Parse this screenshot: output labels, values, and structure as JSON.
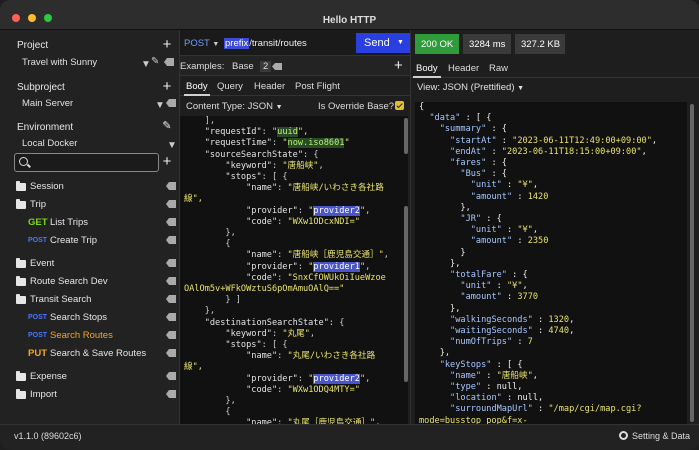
{
  "window": {
    "title": "Hello HTTP"
  },
  "colors": {
    "get": "#7ed321",
    "post": "#4a76ff",
    "put": "#f5a623",
    "ok": "#2e9c3a",
    "send": "#2a3fe0"
  },
  "sidebar": {
    "project_label": "Project",
    "project_value": "Travel with Sunny",
    "subproject_label": "Subproject",
    "subproject_value": "Main Server",
    "environment_label": "Environment",
    "environment_value": "Local Docker",
    "search_placeholder": "",
    "tree": [
      {
        "type": "folder",
        "label": "Session"
      },
      {
        "type": "folder",
        "label": "Trip"
      },
      {
        "type": "request",
        "method": "GET",
        "label": "List Trips"
      },
      {
        "type": "request",
        "method": "POST",
        "label": "Create Trip"
      },
      {
        "type": "folder",
        "label": "Event"
      },
      {
        "type": "folder",
        "label": "Route Search Dev"
      },
      {
        "type": "folder",
        "label": "Transit Search"
      },
      {
        "type": "request",
        "method": "POST",
        "label": "Search Stops"
      },
      {
        "type": "request",
        "method": "POST",
        "label": "Search Routes"
      },
      {
        "type": "request",
        "method": "PUT",
        "label": "Search & Save Routes"
      },
      {
        "type": "folder",
        "label": "Expense"
      },
      {
        "type": "folder",
        "label": "Import"
      }
    ]
  },
  "request": {
    "method": "POST",
    "url_var": "prefix",
    "url_path": "/transit/routes",
    "send_label": "Send",
    "examples_label": "Examples:",
    "example_base": "Base",
    "example_2": "2",
    "tabs": [
      "Body",
      "Query",
      "Header",
      "Post Flight"
    ],
    "content_type": "Content Type: JSON",
    "override_label": "Is Override Base?",
    "body_lines": [
      "    ],",
      "    \"requestId\": \"uuid\",",
      "    \"requestTime\": \"now.iso8601\"",
      "    \"sourceSearchState\": {",
      "        \"keyword\": \"唐船峡\",",
      "        \"stops\": [ {",
      "            \"name\": \"唐船峡/いわさき各社路",
      "線\",",
      "            \"provider\": \"provider2\",",
      "            \"code\": \"WXw1ODcxNDI=\"",
      "        },",
      "        {",
      "            \"name\": \"唐船峡［鹿児島交通］\",",
      "            \"provider\": \"provider1\",",
      "            \"code\": \"SnxCfOWUkOiIueWzoe",
      "OAlOm5v+WFkOWztuS6pOmAmuOAlQ==\"",
      "        } ]",
      "    },",
      "    \"destinationSearchState\": {",
      "        \"keyword\": \"丸尾\",",
      "        \"stops\": [ {",
      "            \"name\": \"丸尾/いわさき各社路",
      "線\",",
      "            \"provider\": \"provider2\",",
      "            \"code\": \"WXw1ODQ4MTY=\"",
      "        },",
      "        {",
      "            \"name\": \"丸尾［鹿児島交通］\","
    ]
  },
  "response": {
    "status": "200 OK",
    "time": "3284 ms",
    "size": "327.2 KB",
    "tabs": [
      "Body",
      "Header",
      "Raw"
    ],
    "view": "View: JSON (Prettified)",
    "body_lines": [
      "{",
      "  \"data\" : [ {",
      "    \"summary\" : {",
      "      \"startAt\" : \"2023-06-11T12:49:00+09:00\",",
      "      \"endAt\" : \"2023-06-11T18:15:00+09:00\",",
      "      \"fares\" : {",
      "        \"Bus\" : {",
      "          \"unit\" : \"¥\",",
      "          \"amount\" : 1420",
      "        },",
      "        \"JR\" : {",
      "          \"unit\" : \"¥\",",
      "          \"amount\" : 2350",
      "        }",
      "      },",
      "      \"totalFare\" : {",
      "        \"unit\" : \"¥\",",
      "        \"amount\" : 3770",
      "      },",
      "      \"walkingSeconds\" : 1320,",
      "      \"waitingSeconds\" : 4740,",
      "      \"numOfTrips\" : 7",
      "    },",
      "    \"keyStops\" : [ {",
      "      \"name\" : \"唐船峡\",",
      "      \"type\" : null,",
      "      \"location\" : null,",
      "      \"surroundMapUrl\" : \"/map/cgi/map.cgi?",
      "mode=busstop_pop&f=x-"
    ]
  },
  "footer": {
    "version": "v1.1.0 (89602c6)",
    "settings": "Setting & Data"
  }
}
